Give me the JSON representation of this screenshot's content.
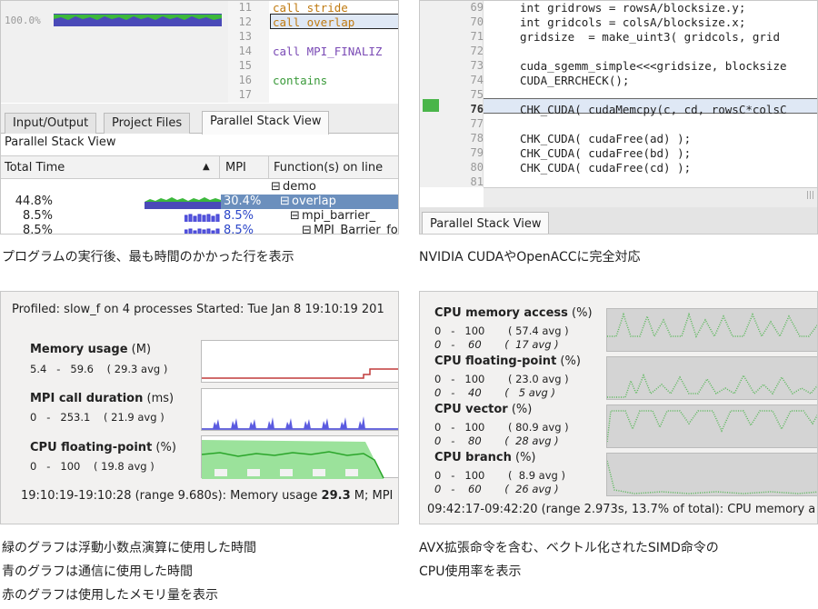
{
  "panel1": {
    "percent_label": "100.0%",
    "lines": [
      {
        "num": "11",
        "text": "call stride"
      },
      {
        "num": "12",
        "text": "call overlap"
      },
      {
        "num": "13",
        "text": ""
      },
      {
        "num": "14",
        "text": "call MPI_FINALIZ"
      },
      {
        "num": "15",
        "text": ""
      },
      {
        "num": "16",
        "text": "contains"
      },
      {
        "num": "17",
        "text": ""
      }
    ],
    "tabs": [
      "Input/Output",
      "Project Files",
      "Parallel Stack View"
    ],
    "view_title": "Parallel Stack View",
    "columns": [
      "Total Time",
      "MPI",
      "Function(s) on line"
    ],
    "rows": [
      {
        "total": "",
        "mpi": "",
        "func": "demo"
      },
      {
        "total": "44.8%",
        "mpi": "30.4%",
        "func": "overlap"
      },
      {
        "total": "8.5%",
        "mpi": "8.5%",
        "func": "mpi_barrier_"
      },
      {
        "total": "8.5%",
        "mpi": "8.5%",
        "func": "MPI_Barrier_for"
      }
    ]
  },
  "panel2": {
    "lines": [
      {
        "num": "69",
        "text": "int gridrows = rowsA/blocksize.y;"
      },
      {
        "num": "70",
        "text": "int gridcols = colsA/blocksize.x;"
      },
      {
        "num": "71",
        "text": "gridsize  = make_uint3( gridcols, grid"
      },
      {
        "num": "72",
        "text": ""
      },
      {
        "num": "73",
        "text": "cuda_sgemm_simple<<<gridsize, blocksize"
      },
      {
        "num": "74",
        "text": "CUDA_ERRCHECK();"
      },
      {
        "num": "75",
        "text": ""
      },
      {
        "num": "76",
        "text": "CHK_CUDA( cudaMemcpy(c, cd, rowsC*colsC"
      },
      {
        "num": "77",
        "text": ""
      },
      {
        "num": "78",
        "text": "CHK_CUDA( cudaFree(ad) );"
      },
      {
        "num": "79",
        "text": "CHK_CUDA( cudaFree(bd) );"
      },
      {
        "num": "80",
        "text": "CHK_CUDA( cudaFree(cd) );"
      },
      {
        "num": "81",
        "text": ""
      }
    ],
    "tab": "Parallel Stack View"
  },
  "captions": {
    "c1": "プログラムの実行後、最も時間のかかった行を表示",
    "c2": "NVIDIA CUDAやOpenACCに完全対応",
    "c3": [
      "緑のグラフは浮動小数点演算に使用した時間",
      "青のグラフは通信に使用した時間",
      "赤のグラフは使用したメモリ量を表示"
    ],
    "c4": [
      "AVX拡張命令を含む、ベクトル化されたSIMD命令の",
      "CPU使用率を表示"
    ]
  },
  "panel3": {
    "header": "Profiled: slow_f on 4 processes   Started: Tue Jan 8 19:10:19 201",
    "metrics": [
      {
        "name": "Memory usage",
        "unit": "(M)",
        "min": "5.4",
        "max": "59.6",
        "avg": "( 29.3 avg )",
        "color": "#c03a3a"
      },
      {
        "name": "MPI call duration",
        "unit": "(ms)",
        "min": "0",
        "max": "253.1",
        "avg": "( 21.9 avg )",
        "color": "#3a3ad0"
      },
      {
        "name": "CPU floating-point",
        "unit": "(%)",
        "min": "0",
        "max": "100",
        "avg": "( 19.8 avg )",
        "color": "#3ac03a"
      }
    ],
    "footer_prefix": "19:10:19-19:10:28 (range 9.680s): Memory usage ",
    "footer_value": "29.3",
    "footer_suffix": " M; MPI"
  },
  "panel4": {
    "metrics": [
      {
        "name": "CPU memory access",
        "unit": "(%)",
        "r1": "0   -   100       ( 57.4 avg )",
        "r2": "0   -    60       (  17 avg )"
      },
      {
        "name": "CPU floating-point",
        "unit": "(%)",
        "r1": "0   -   100       ( 23.0 avg )",
        "r2": "0   -    40       (   5 avg )"
      },
      {
        "name": "CPU vector",
        "unit": "(%)",
        "r1": "0   -   100       ( 80.9 avg )",
        "r2": "0   -    80       (  28 avg )"
      },
      {
        "name": "CPU branch",
        "unit": "(%)",
        "r1": "0   -   100       (  8.9 avg )",
        "r2": "0   -    60       (  26 avg )"
      }
    ],
    "footer": "09:42:17-09:42:20 (range 2.973s, 13.7% of total): CPU memory a"
  }
}
